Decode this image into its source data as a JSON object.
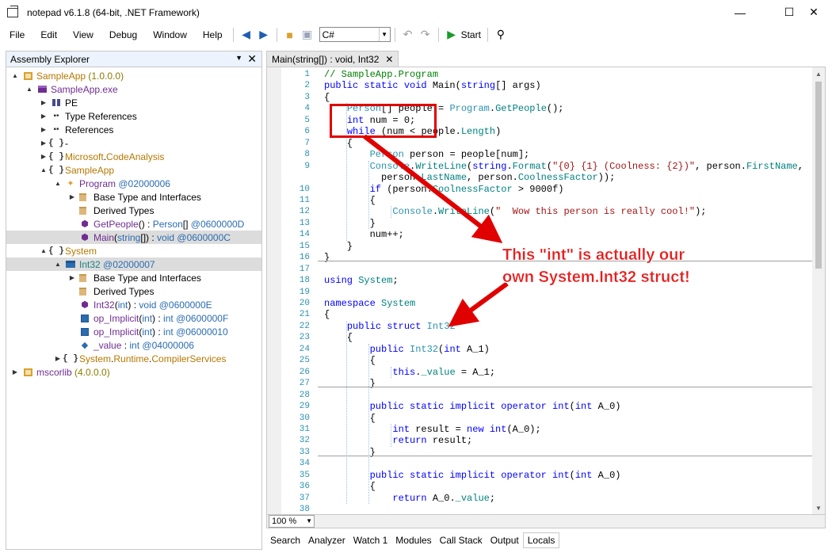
{
  "window": {
    "title": "notepad v6.1.8 (64-bit, .NET Framework)",
    "controls": [
      "—",
      "☐",
      "✕"
    ]
  },
  "menu": [
    "File",
    "Edit",
    "View",
    "Debug",
    "Window",
    "Help"
  ],
  "toolbar": {
    "language": "C#",
    "start_label": "Start"
  },
  "assembly_explorer": {
    "title": "Assembly Explorer",
    "rows": [
      {
        "parts": [
          {
            "t": "SampleApp ",
            "c": "c-orange"
          },
          {
            "t": "(1.0.0.0)",
            "c": "c-olive"
          }
        ]
      },
      {
        "parts": [
          {
            "t": "SampleApp.exe",
            "c": "c-purple"
          }
        ]
      },
      {
        "parts": [
          {
            "t": "PE",
            "c": ""
          }
        ]
      },
      {
        "parts": [
          {
            "t": "Type References",
            "c": ""
          }
        ]
      },
      {
        "parts": [
          {
            "t": "References",
            "c": ""
          }
        ]
      },
      {
        "parts": [
          {
            "t": "-",
            "c": ""
          }
        ]
      },
      {
        "parts": [
          {
            "t": "Microsoft",
            "c": "c-orange"
          },
          {
            "t": ".",
            "c": ""
          },
          {
            "t": "CodeAnalysis",
            "c": "c-orange"
          }
        ]
      },
      {
        "parts": [
          {
            "t": "SampleApp",
            "c": "c-orange"
          }
        ]
      },
      {
        "parts": [
          {
            "t": "Program ",
            "c": "c-purple"
          },
          {
            "t": "@02000006",
            "c": "c-blue"
          }
        ]
      },
      {
        "parts": [
          {
            "t": "Base Type and Interfaces",
            "c": ""
          }
        ]
      },
      {
        "parts": [
          {
            "t": "Derived Types",
            "c": ""
          }
        ]
      },
      {
        "parts": [
          {
            "t": "GetPeople",
            "c": "c-purple"
          },
          {
            "t": "() : ",
            "c": ""
          },
          {
            "t": "Person",
            "c": "c-blue"
          },
          {
            "t": "[] ",
            "c": ""
          },
          {
            "t": "@0600000D",
            "c": "c-blue"
          }
        ]
      },
      {
        "parts": [
          {
            "t": "Main",
            "c": "c-purple"
          },
          {
            "t": "(",
            "c": ""
          },
          {
            "t": "string",
            "c": "c-blue"
          },
          {
            "t": "[]) : ",
            "c": ""
          },
          {
            "t": "void",
            "c": "c-blue"
          },
          {
            "t": " @0600000C",
            "c": "c-blue"
          }
        ]
      },
      {
        "parts": [
          {
            "t": "System",
            "c": "c-orange"
          }
        ]
      },
      {
        "parts": [
          {
            "t": "Int32 ",
            "c": "c-teal"
          },
          {
            "t": "@02000007",
            "c": "c-blue"
          }
        ]
      },
      {
        "parts": [
          {
            "t": "Base Type and Interfaces",
            "c": ""
          }
        ]
      },
      {
        "parts": [
          {
            "t": "Derived Types",
            "c": ""
          }
        ]
      },
      {
        "parts": [
          {
            "t": "Int32",
            "c": "c-purple"
          },
          {
            "t": "(",
            "c": ""
          },
          {
            "t": "int",
            "c": "c-blue"
          },
          {
            "t": ") : ",
            "c": ""
          },
          {
            "t": "void",
            "c": "c-blue"
          },
          {
            "t": " @0600000E",
            "c": "c-blue"
          }
        ]
      },
      {
        "parts": [
          {
            "t": "op_Implicit",
            "c": "c-purple"
          },
          {
            "t": "(",
            "c": ""
          },
          {
            "t": "int",
            "c": "c-blue"
          },
          {
            "t": ") : ",
            "c": ""
          },
          {
            "t": "int",
            "c": "c-blue"
          },
          {
            "t": " @0600000F",
            "c": "c-blue"
          }
        ]
      },
      {
        "parts": [
          {
            "t": "op_Implicit",
            "c": "c-purple"
          },
          {
            "t": "(",
            "c": ""
          },
          {
            "t": "int",
            "c": "c-blue"
          },
          {
            "t": ") : ",
            "c": ""
          },
          {
            "t": "int",
            "c": "c-blue"
          },
          {
            "t": " @06000010",
            "c": "c-blue"
          }
        ]
      },
      {
        "parts": [
          {
            "t": "_value",
            "c": "c-purple"
          },
          {
            "t": " : ",
            "c": ""
          },
          {
            "t": "int",
            "c": "c-blue"
          },
          {
            "t": " @04000006",
            "c": "c-blue"
          }
        ]
      },
      {
        "parts": [
          {
            "t": "System",
            "c": "c-orange"
          },
          {
            "t": ".",
            "c": ""
          },
          {
            "t": "Runtime",
            "c": "c-orange"
          },
          {
            "t": ".",
            "c": ""
          },
          {
            "t": "CompilerServices",
            "c": "c-orange"
          }
        ]
      },
      {
        "parts": [
          {
            "t": "mscorlib ",
            "c": "c-purple"
          },
          {
            "t": "(4.0.0.0)",
            "c": "c-olive"
          }
        ]
      }
    ]
  },
  "document_tab": {
    "title": "Main(string[]) : void, Int32"
  },
  "code": {
    "lines": [
      {
        "n": "1",
        "p": [
          {
            "t": "// SampleApp.Program",
            "c": "cm"
          }
        ]
      },
      {
        "n": "2",
        "p": [
          {
            "t": "public static void ",
            "c": "kw"
          },
          {
            "t": "Main(",
            "c": ""
          },
          {
            "t": "string",
            "c": "kw"
          },
          {
            "t": "[] args)",
            "c": ""
          }
        ]
      },
      {
        "n": "3",
        "p": [
          {
            "t": "{",
            "c": ""
          }
        ]
      },
      {
        "n": "4",
        "p": [
          {
            "t": "    ",
            "c": ""
          },
          {
            "t": "Person",
            "c": "ty"
          },
          {
            "t": "[] people = ",
            "c": ""
          },
          {
            "t": "Program",
            "c": "ty"
          },
          {
            "t": ".",
            "c": ""
          },
          {
            "t": "GetPeople",
            "c": "ns"
          },
          {
            "t": "();",
            "c": ""
          }
        ]
      },
      {
        "n": "5",
        "p": [
          {
            "t": "    ",
            "c": ""
          },
          {
            "t": "int",
            "c": "kw"
          },
          {
            "t": " num = 0;",
            "c": ""
          }
        ]
      },
      {
        "n": "6",
        "p": [
          {
            "t": "    ",
            "c": ""
          },
          {
            "t": "while",
            "c": "kw"
          },
          {
            "t": " (num < people.",
            "c": ""
          },
          {
            "t": "Length",
            "c": "ns"
          },
          {
            "t": ")",
            "c": ""
          }
        ]
      },
      {
        "n": "7",
        "p": [
          {
            "t": "    {",
            "c": ""
          }
        ]
      },
      {
        "n": "8",
        "p": [
          {
            "t": "        ",
            "c": ""
          },
          {
            "t": "Person",
            "c": "ty"
          },
          {
            "t": " person = people[num];",
            "c": ""
          }
        ]
      },
      {
        "n": "9",
        "p": [
          {
            "t": "        ",
            "c": ""
          },
          {
            "t": "Console",
            "c": "ty"
          },
          {
            "t": ".",
            "c": ""
          },
          {
            "t": "WriteLine",
            "c": "ns"
          },
          {
            "t": "(",
            "c": ""
          },
          {
            "t": "string",
            "c": "kw"
          },
          {
            "t": ".",
            "c": ""
          },
          {
            "t": "Format",
            "c": "ns"
          },
          {
            "t": "(",
            "c": ""
          },
          {
            "t": "\"{0} {1} (Coolness: {2})\"",
            "c": "str"
          },
          {
            "t": ", person.",
            "c": ""
          },
          {
            "t": "FirstName",
            "c": "ns"
          },
          {
            "t": ",",
            "c": ""
          }
        ]
      },
      {
        "n": "",
        "p": [
          {
            "t": "          person.",
            "c": ""
          },
          {
            "t": "LastName",
            "c": "ns"
          },
          {
            "t": ", person.",
            "c": ""
          },
          {
            "t": "CoolnessFactor",
            "c": "ns"
          },
          {
            "t": "));",
            "c": ""
          }
        ]
      },
      {
        "n": "10",
        "p": [
          {
            "t": "        ",
            "c": ""
          },
          {
            "t": "if",
            "c": "kw"
          },
          {
            "t": " (person.",
            "c": ""
          },
          {
            "t": "CoolnessFactor",
            "c": "ns"
          },
          {
            "t": " > 9000f)",
            "c": ""
          }
        ]
      },
      {
        "n": "11",
        "p": [
          {
            "t": "        {",
            "c": ""
          }
        ]
      },
      {
        "n": "12",
        "p": [
          {
            "t": "            ",
            "c": ""
          },
          {
            "t": "Console",
            "c": "ty"
          },
          {
            "t": ".",
            "c": ""
          },
          {
            "t": "WriteLine",
            "c": "ns"
          },
          {
            "t": "(",
            "c": ""
          },
          {
            "t": "\"  Wow this person is really cool!\"",
            "c": "str"
          },
          {
            "t": ");",
            "c": ""
          }
        ]
      },
      {
        "n": "13",
        "p": [
          {
            "t": "        }",
            "c": ""
          }
        ]
      },
      {
        "n": "14",
        "p": [
          {
            "t": "        num++;",
            "c": ""
          }
        ]
      },
      {
        "n": "15",
        "p": [
          {
            "t": "    }",
            "c": ""
          }
        ]
      },
      {
        "n": "16",
        "p": [
          {
            "t": "}",
            "c": ""
          }
        ]
      },
      {
        "n": "17",
        "p": []
      },
      {
        "n": "18",
        "p": [
          {
            "t": "using",
            "c": "kw"
          },
          {
            "t": " ",
            "c": ""
          },
          {
            "t": "System",
            "c": "ns"
          },
          {
            "t": ";",
            "c": ""
          }
        ]
      },
      {
        "n": "19",
        "p": []
      },
      {
        "n": "20",
        "p": [
          {
            "t": "namespace",
            "c": "kw"
          },
          {
            "t": " ",
            "c": ""
          },
          {
            "t": "System",
            "c": "ns"
          }
        ]
      },
      {
        "n": "21",
        "p": [
          {
            "t": "{",
            "c": ""
          }
        ]
      },
      {
        "n": "22",
        "p": [
          {
            "t": "    ",
            "c": ""
          },
          {
            "t": "public struct ",
            "c": "kw"
          },
          {
            "t": "Int32",
            "c": "ty"
          }
        ]
      },
      {
        "n": "23",
        "p": [
          {
            "t": "    {",
            "c": ""
          }
        ]
      },
      {
        "n": "24",
        "p": [
          {
            "t": "        ",
            "c": ""
          },
          {
            "t": "public ",
            "c": "kw"
          },
          {
            "t": "Int32",
            "c": "ty"
          },
          {
            "t": "(",
            "c": ""
          },
          {
            "t": "int",
            "c": "kw"
          },
          {
            "t": " A_1)",
            "c": ""
          }
        ]
      },
      {
        "n": "25",
        "p": [
          {
            "t": "        {",
            "c": ""
          }
        ]
      },
      {
        "n": "26",
        "p": [
          {
            "t": "            ",
            "c": ""
          },
          {
            "t": "this",
            "c": "kw"
          },
          {
            "t": ".",
            "c": ""
          },
          {
            "t": "_value",
            "c": "ns"
          },
          {
            "t": " = A_1;",
            "c": ""
          }
        ]
      },
      {
        "n": "27",
        "p": [
          {
            "t": "        }",
            "c": ""
          }
        ]
      },
      {
        "n": "28",
        "p": []
      },
      {
        "n": "29",
        "p": [
          {
            "t": "        ",
            "c": ""
          },
          {
            "t": "public static implicit operator int",
            "c": "kw"
          },
          {
            "t": "(",
            "c": ""
          },
          {
            "t": "int",
            "c": "kw"
          },
          {
            "t": " A_0)",
            "c": ""
          }
        ]
      },
      {
        "n": "30",
        "p": [
          {
            "t": "        {",
            "c": ""
          }
        ]
      },
      {
        "n": "31",
        "p": [
          {
            "t": "            ",
            "c": ""
          },
          {
            "t": "int",
            "c": "kw"
          },
          {
            "t": " result = ",
            "c": ""
          },
          {
            "t": "new int",
            "c": "kw"
          },
          {
            "t": "(A_0);",
            "c": ""
          }
        ]
      },
      {
        "n": "32",
        "p": [
          {
            "t": "            ",
            "c": ""
          },
          {
            "t": "return",
            "c": "kw"
          },
          {
            "t": " result;",
            "c": ""
          }
        ]
      },
      {
        "n": "33",
        "p": [
          {
            "t": "        }",
            "c": ""
          }
        ]
      },
      {
        "n": "34",
        "p": []
      },
      {
        "n": "35",
        "p": [
          {
            "t": "        ",
            "c": ""
          },
          {
            "t": "public static implicit operator int",
            "c": "kw"
          },
          {
            "t": "(",
            "c": ""
          },
          {
            "t": "int",
            "c": "kw"
          },
          {
            "t": " A_0)",
            "c": ""
          }
        ]
      },
      {
        "n": "36",
        "p": [
          {
            "t": "        {",
            "c": ""
          }
        ]
      },
      {
        "n": "37",
        "p": [
          {
            "t": "            ",
            "c": ""
          },
          {
            "t": "return",
            "c": "kw"
          },
          {
            "t": " A_0.",
            "c": ""
          },
          {
            "t": "_value",
            "c": "ns"
          },
          {
            "t": ";",
            "c": ""
          }
        ]
      },
      {
        "n": "38",
        "p": []
      }
    ]
  },
  "zoom": {
    "value": "100 %"
  },
  "bottom_tabs": [
    "Search",
    "Analyzer",
    "Watch 1",
    "Modules",
    "Call Stack",
    "Output",
    "Locals"
  ],
  "annotation": {
    "line1": "This \"int\" is actually our",
    "line2": "own System.Int32 struct!",
    "color": "#e81c1c"
  }
}
